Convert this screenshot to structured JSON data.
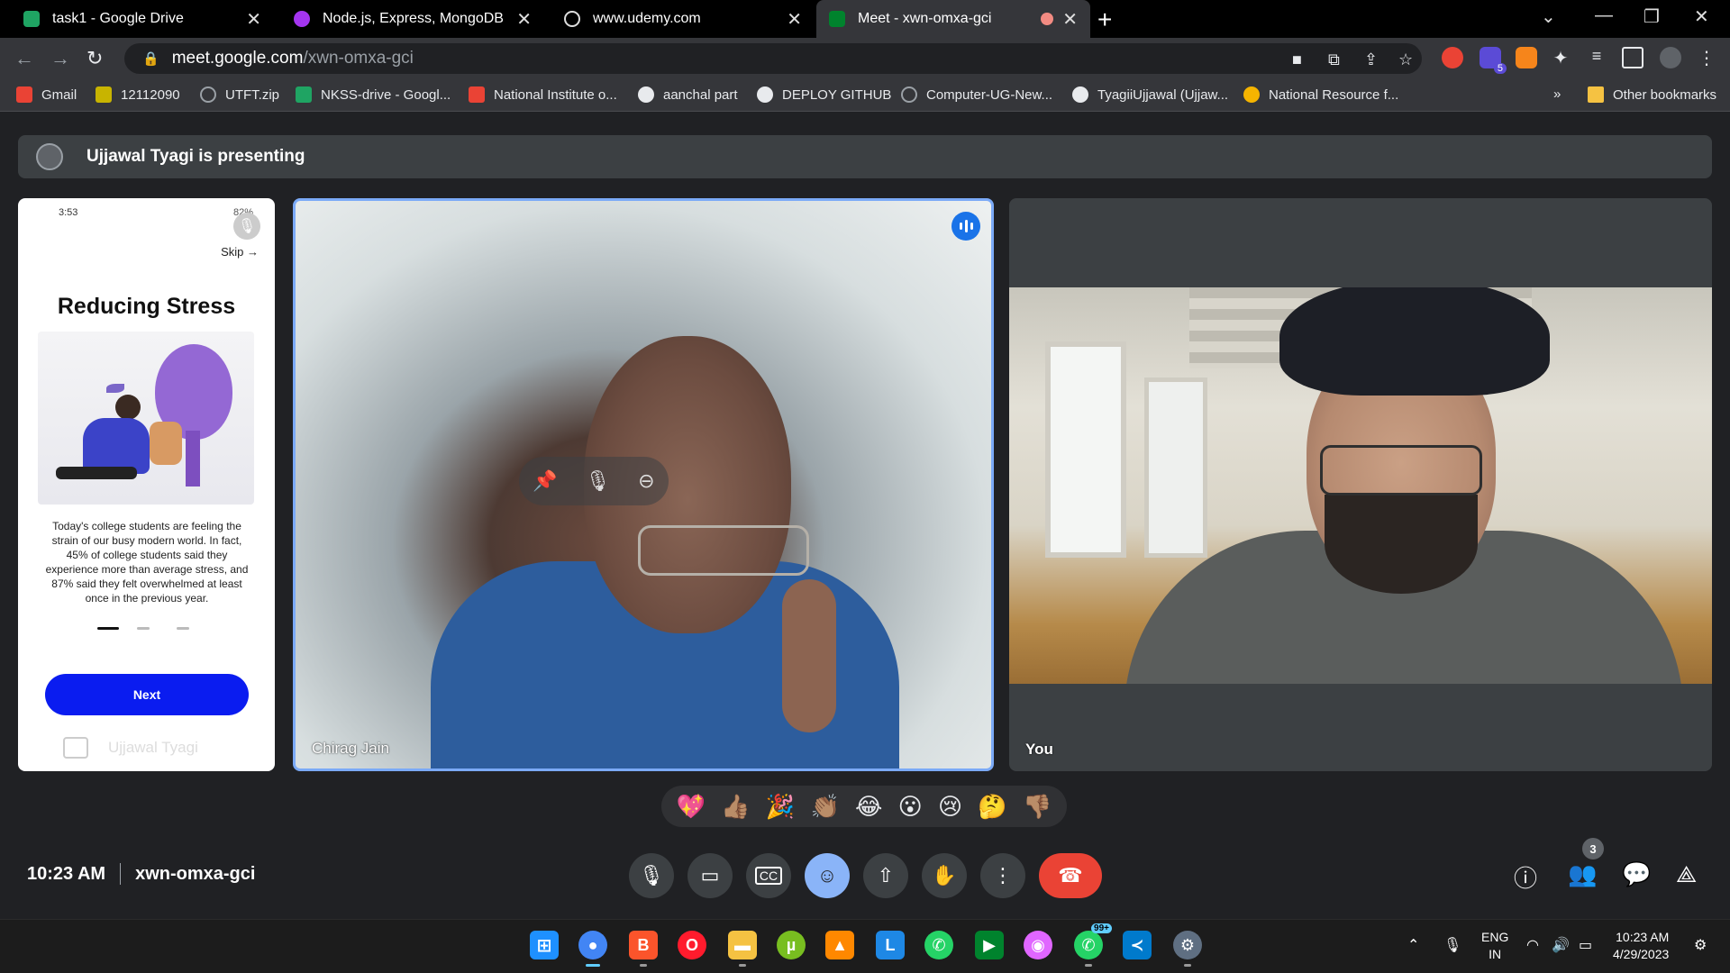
{
  "browser": {
    "tabs": [
      {
        "title": "task1 - Google Drive",
        "favicon_color": "#1fa463"
      },
      {
        "title": "Node.js, Express, MongoDB & Mo",
        "favicon_color": "#a435f0"
      },
      {
        "title": "www.udemy.com",
        "favicon_color": "#9aa0a6"
      },
      {
        "title": "Meet - xwn-omxa-gci",
        "favicon_color": "#00832d",
        "active": true
      }
    ],
    "url_host": "meet.google.com",
    "url_path": "/xwn-omxa-gci",
    "extension_badge": "5",
    "bookmarks": [
      {
        "label": "Gmail",
        "icon_color": "#ea4335"
      },
      {
        "label": "12112090",
        "icon_color": "#c8b400"
      },
      {
        "label": "UTFT.zip",
        "icon_color": "#9aa0a6"
      },
      {
        "label": "NKSS-drive - Googl...",
        "icon_color": "#1fa463"
      },
      {
        "label": "National Institute o...",
        "icon_color": "#ea4335"
      },
      {
        "label": "aanchal part",
        "icon_color": "#e8eaed"
      },
      {
        "label": "DEPLOY GITHUB",
        "icon_color": "#e8eaed"
      },
      {
        "label": "Computer-UG-New...",
        "icon_color": "#9aa0a6"
      },
      {
        "label": "TyagiiUjjawal (Ujjaw...",
        "icon_color": "#e8eaed"
      },
      {
        "label": "National Resource f...",
        "icon_color": "#f5b400"
      }
    ],
    "other_bookmarks": "Other bookmarks",
    "bookmarks_overflow": "»"
  },
  "meet": {
    "presenting_text": "Ujjawal Tyagi is presenting",
    "share": {
      "status_time": "3:53",
      "status_right": "82%",
      "skip_label": "Skip",
      "title": "Reducing Stress",
      "body": "Today's college students are feeling the strain of our busy modern world. In fact, 45% of college students said they experience more than average stress, and 87% said they felt overwhelmed at least once in the previous year.",
      "next_label": "Next",
      "presenter_name": "Ujjawal Tyagi"
    },
    "participants": [
      {
        "name": "Chirag Jain",
        "speaking": true
      },
      {
        "name": "You"
      }
    ],
    "reactions": [
      "💖",
      "👍🏽",
      "🎉",
      "👏🏽",
      "😂",
      "😮",
      "😢",
      "🤔",
      "👎🏽"
    ],
    "time": "10:23 AM",
    "meeting_code": "xwn-omxa-gci",
    "people_count": "3"
  },
  "taskbar": {
    "whatsapp_badge": "99+",
    "lang_top": "ENG",
    "lang_bottom": "IN",
    "clock_time": "10:23 AM",
    "clock_date": "4/29/2023"
  }
}
